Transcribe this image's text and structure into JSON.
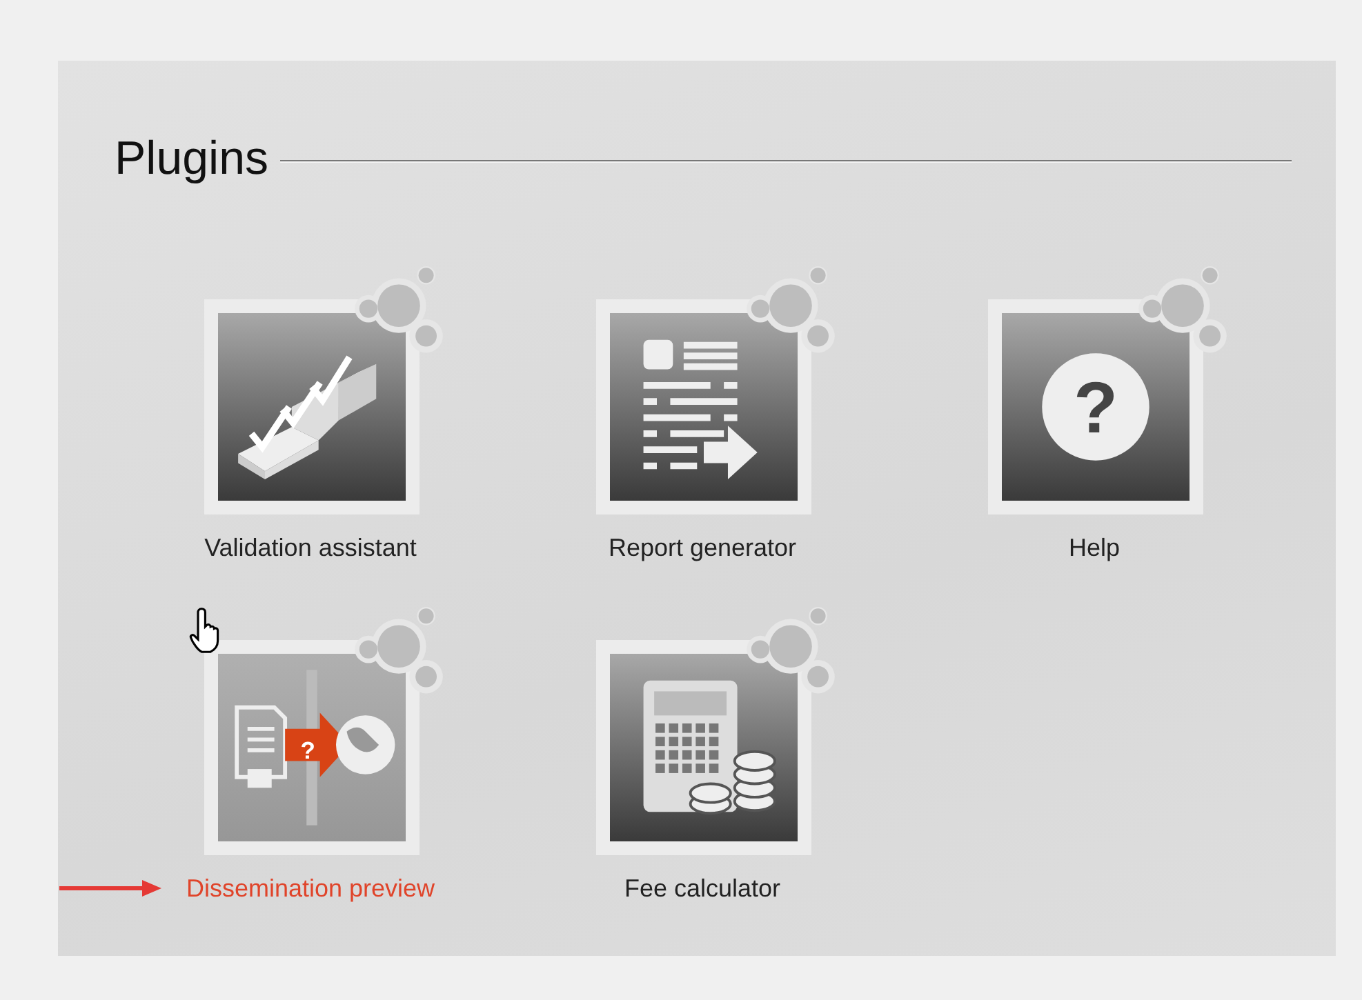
{
  "panel": {
    "title": "Plugins"
  },
  "plugins": [
    {
      "kind": "validation",
      "label": "Validation assistant",
      "selected": false
    },
    {
      "kind": "report",
      "label": "Report generator",
      "selected": false
    },
    {
      "kind": "help",
      "label": "Help",
      "selected": false,
      "icon_text": "?"
    },
    {
      "kind": "dissemination",
      "label": "Dissemination preview",
      "selected": true,
      "icon_text": "?"
    },
    {
      "kind": "fee",
      "label": "Fee calculator",
      "selected": false
    }
  ]
}
